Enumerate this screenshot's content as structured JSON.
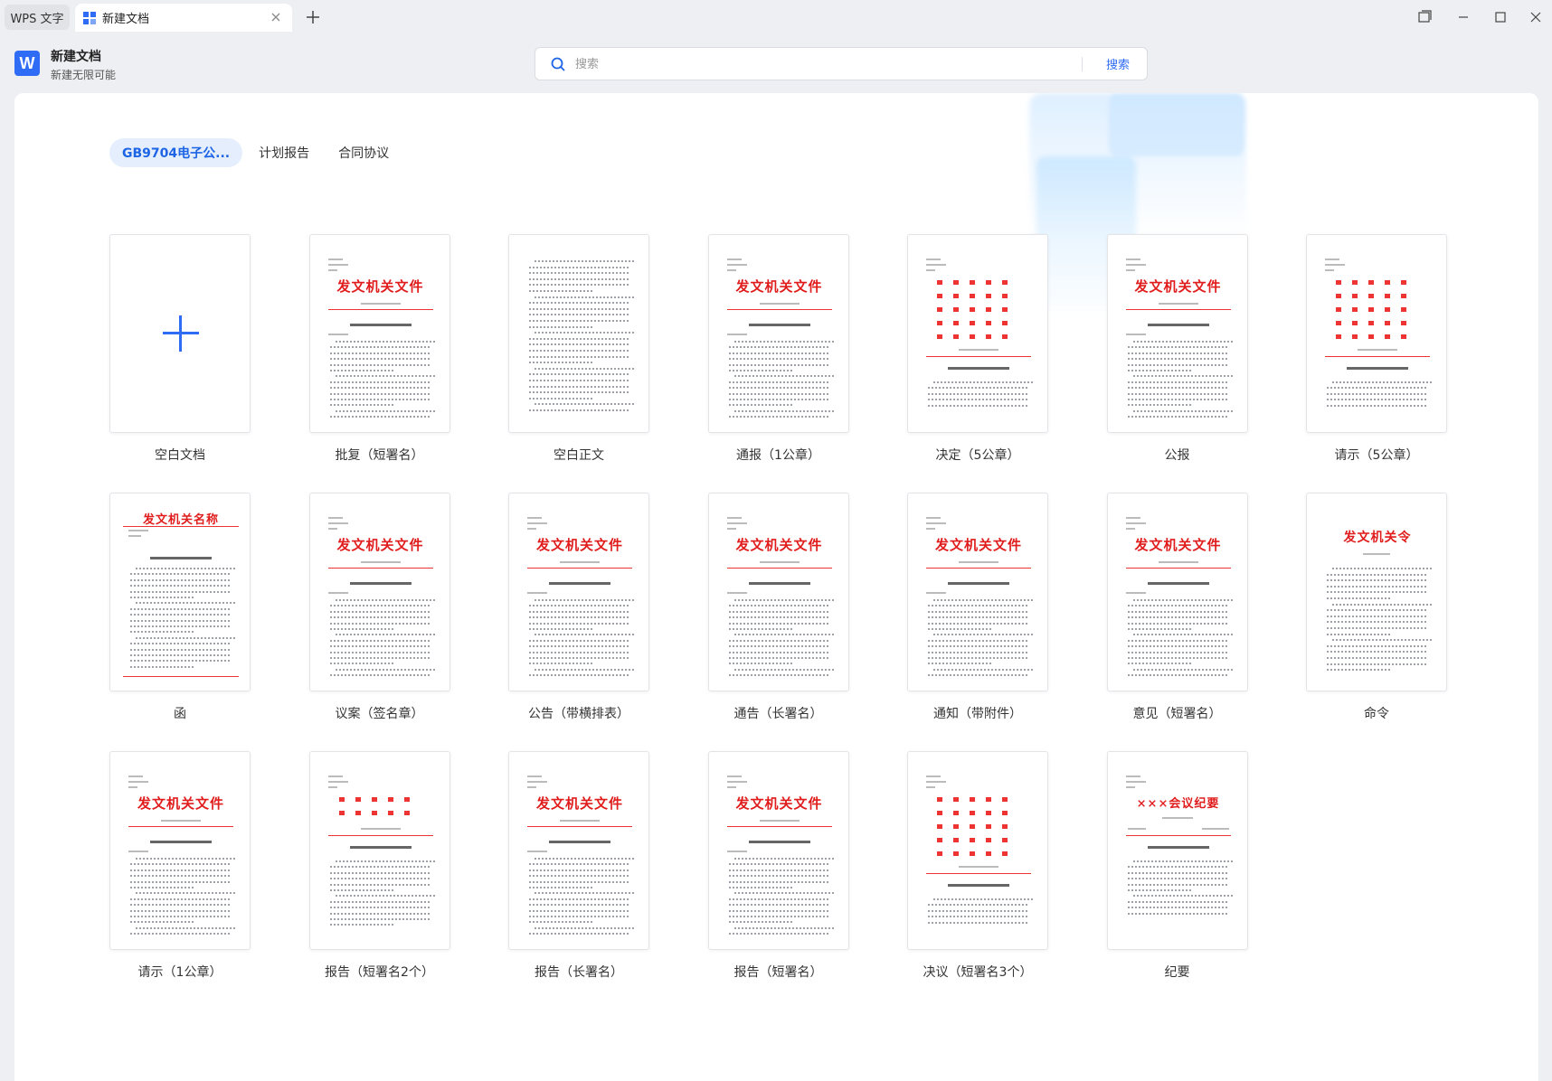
{
  "tabbar": {
    "app_tab": "WPS 文字",
    "doc_tab": "新建文档"
  },
  "header": {
    "title": "新建文档",
    "subtitle": "新建无限可能",
    "logo_letter": "W"
  },
  "search": {
    "placeholder": "搜索",
    "button": "搜索"
  },
  "categories": [
    "GB9704电子公...",
    "计划报告",
    "合同协议"
  ],
  "templates": [
    {
      "label": "空白文档",
      "style": "blank"
    },
    {
      "label": "批复（短署名）",
      "style": "file",
      "head": "发文机关文件"
    },
    {
      "label": "空白正文",
      "style": "text"
    },
    {
      "label": "通报（1公章）",
      "style": "file",
      "head": "发文机关文件"
    },
    {
      "label": "决定（5公章）",
      "style": "multi"
    },
    {
      "label": "公报",
      "style": "file",
      "head": "发文机关文件"
    },
    {
      "label": "请示（5公章）",
      "style": "multi"
    },
    {
      "label": "函",
      "style": "letter",
      "head": "发文机关名称"
    },
    {
      "label": "议案（签名章）",
      "style": "file",
      "head": "发文机关文件"
    },
    {
      "label": "公告（带横排表）",
      "style": "file",
      "head": "发文机关文件"
    },
    {
      "label": "通告（长署名）",
      "style": "file",
      "head": "发文机关文件"
    },
    {
      "label": "通知（带附件）",
      "style": "file",
      "head": "发文机关文件"
    },
    {
      "label": "意见（短署名）",
      "style": "file",
      "head": "发文机关文件"
    },
    {
      "label": "命令",
      "style": "order",
      "head": "发文机关令"
    },
    {
      "label": "请示（1公章）",
      "style": "file",
      "head": "发文机关文件"
    },
    {
      "label": "报告（短署名2个）",
      "style": "multi2"
    },
    {
      "label": "报告（长署名）",
      "style": "file",
      "head": "发文机关文件"
    },
    {
      "label": "报告（短署名）",
      "style": "file",
      "head": "发文机关文件"
    },
    {
      "label": "决议（短署名3个）",
      "style": "multi"
    },
    {
      "label": "纪要",
      "style": "minutes",
      "head": "×××会议纪要"
    }
  ],
  "colors": {
    "accent": "#2f6cf6",
    "doc_red": "#e01c1c"
  }
}
